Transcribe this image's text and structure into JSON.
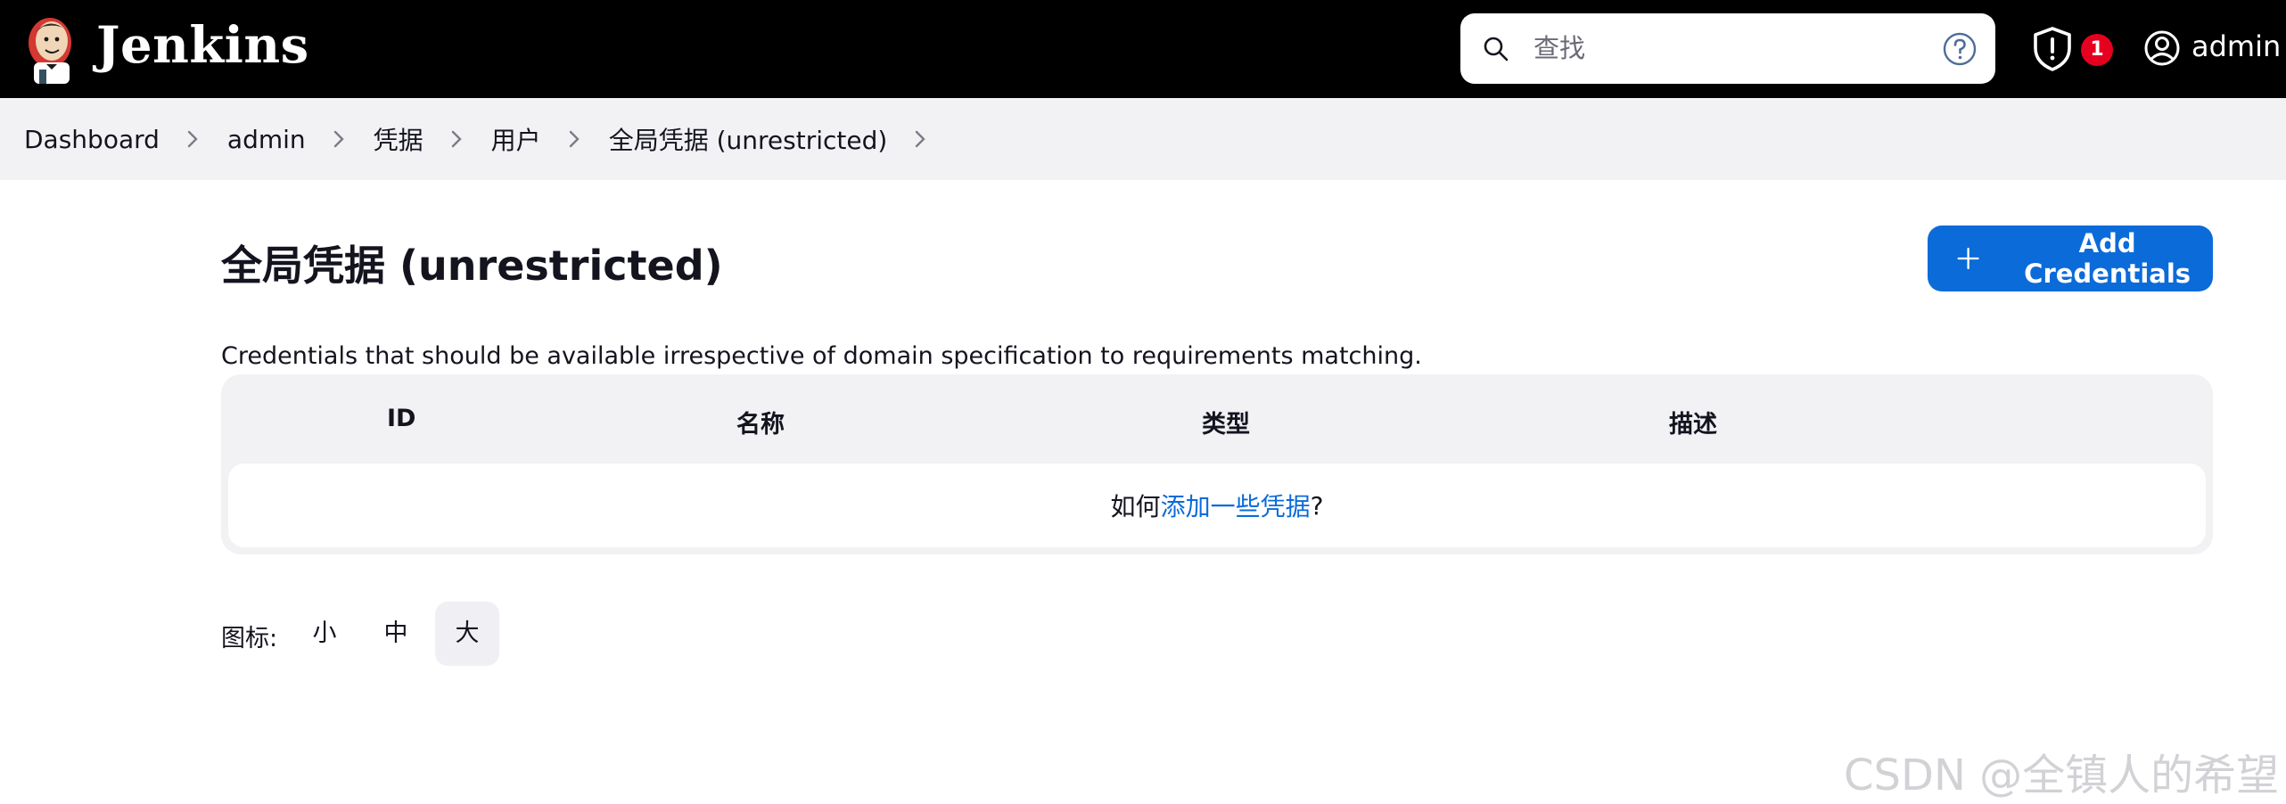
{
  "header": {
    "brand": "Jenkins",
    "search_placeholder": "查找",
    "security_badge_count": "1",
    "user": "admin"
  },
  "breadcrumb": [
    "Dashboard",
    "admin",
    "凭据",
    "用户",
    "全局凭据 (unrestricted)"
  ],
  "main": {
    "title": "全局凭据 (unrestricted)",
    "add_button": "Add Credentials",
    "description": "Credentials that should be available irrespective of domain specification to requirements matching.",
    "table": {
      "columns": [
        "ID",
        "名称",
        "类型",
        "描述"
      ],
      "empty_prefix": "如何",
      "empty_link": "添加一些凭据",
      "empty_suffix": "?"
    },
    "icon_size": {
      "label": "图标:",
      "options": [
        "小",
        "中",
        "大"
      ],
      "selected": "大"
    }
  },
  "watermark": "CSDN @全镇人的希望",
  "colors": {
    "header_bg": "#000000",
    "accent": "#0b6bd9",
    "badge": "#e6001f",
    "breadcrumb_bg": "#f2f2f5"
  },
  "icons": [
    "jenkins-logo-icon",
    "search-icon",
    "help-icon",
    "shield-icon",
    "user-icon",
    "chevron-right-icon",
    "plus-icon"
  ]
}
